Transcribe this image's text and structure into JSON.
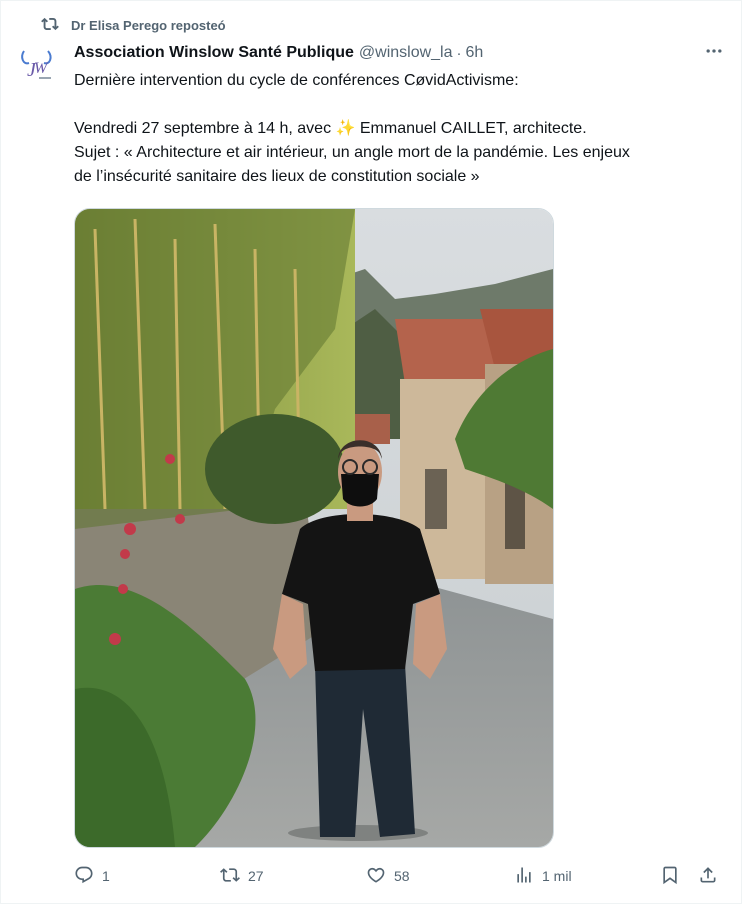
{
  "repost": {
    "text": "Dr Elisa Perego reposteó",
    "icon": "repost-icon"
  },
  "post": {
    "author_name": "Association Winslow Santé Publique",
    "handle": "@winslow_la",
    "separator": "·",
    "time": "6h",
    "line1": "Dernière intervention du cycle de conférences CøvidActivisme:",
    "line2_before": "Vendredi 27 septembre à 14 h, avec ",
    "sparkle": "✨",
    "line2_after": " Emmanuel CAILLET, architecte.",
    "line3": "Sujet : « Architecture et air intérieur, un angle mort de la pandémie. Les enjeux",
    "line4": "de l’insécurité sanitaire des lieux de constitution sociale »",
    "avatar_text": "W"
  },
  "actions": {
    "replies": "1",
    "reposts": "27",
    "likes": "58",
    "views": "1 mil"
  },
  "colors": {
    "text": "#0f1419",
    "muted": "#536471",
    "border": "#eff3f4"
  }
}
